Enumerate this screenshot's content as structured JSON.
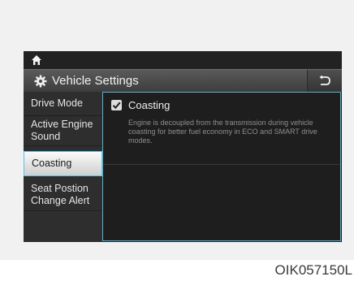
{
  "header": {
    "title": "Vehicle Settings",
    "icons": [
      "home-icon",
      "gear-icon",
      "back-icon"
    ]
  },
  "sidebar": {
    "items": [
      {
        "label": "Drive Mode",
        "selected": false
      },
      {
        "label": "Active Engine Sound",
        "selected": false
      },
      {
        "label": "Coasting",
        "selected": true
      },
      {
        "label": "Seat Postion Change Alert",
        "selected": false
      }
    ]
  },
  "content": {
    "option": {
      "label": "Coasting",
      "checked": true,
      "description": "Engine is decoupled from the transmission during vehicle coasting for better fuel economy in ECO and SMART drive modes."
    }
  },
  "caption": "OIK057150L",
  "colors": {
    "accent": "#4fb6d8",
    "background": "#1e1e1e",
    "selected_item": "#e8e8e8"
  }
}
